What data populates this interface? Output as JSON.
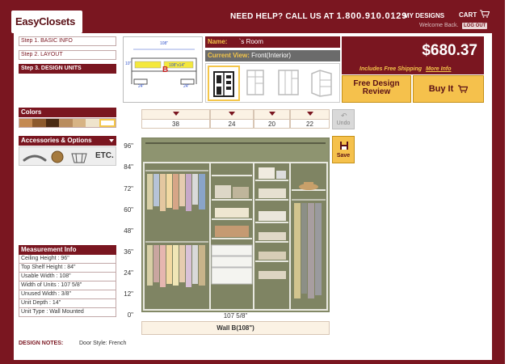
{
  "header": {
    "logo": "EasyClosets",
    "help_prefix": "NEED HELP? CALL US AT",
    "phone": "1.800.910.0129",
    "my_designs": "MY DESIGNS",
    "cart": "CART",
    "welcome": "Welcome Back.",
    "logout": "LOG OUT"
  },
  "steps": [
    {
      "label": "Step 1. BASIC INFO"
    },
    {
      "label": "Step 2. LAYOUT"
    },
    {
      "label": "Step 3. DESIGN UNITS"
    }
  ],
  "layout_diagram": {
    "top_dim": "108\"",
    "left_dim": "10\"",
    "unit_dims": "108\"x14\"",
    "wall_letter": "B",
    "bottom_left": "24\"",
    "bottom_right": "24\""
  },
  "room": {
    "name_label": "Name:",
    "name_value": "`s Room",
    "view_label": "Current View:",
    "view_value": "Front(Interior)"
  },
  "pricing": {
    "price": "$680.37",
    "shipping": "Includes Free Shipping",
    "more_info": "More Info"
  },
  "buttons": {
    "review_line1": "Free Design",
    "review_line2": "Review",
    "buy": "Buy It",
    "undo": "Undo",
    "save": "Save"
  },
  "colors": {
    "title": "Colors",
    "swatches": [
      "#c48a52",
      "#8d5a2c",
      "#4a2a12",
      "#b98c5e",
      "#d7b384",
      "#efe4cc",
      "#ffffff"
    ]
  },
  "accessories": {
    "title": "Accessories & Options",
    "etc": "ETC."
  },
  "measurement": {
    "title": "Measurement Info",
    "rows": [
      "Ceiling Height : 96\"",
      "Top Shelf Height : 84\"",
      "Usable Width : 108\"",
      "Width of Units : 107 5/8\"",
      "Unused Width : 3/8\"",
      "Unit Depth : 14\"",
      "Unit Type : Wall Mounted"
    ]
  },
  "notes": {
    "label": "DESIGN NOTES:",
    "value": "Door Style: French"
  },
  "unit_widths": [
    "38",
    "24",
    "20",
    "22"
  ],
  "y_ticks": [
    "96\"",
    "84\"",
    "72\"",
    "60\"",
    "48\"",
    "36\"",
    "24\"",
    "12\"",
    "0\""
  ],
  "canvas": {
    "width_dim": "107 5/8\"",
    "wall_label": "Wall B(108\")"
  }
}
